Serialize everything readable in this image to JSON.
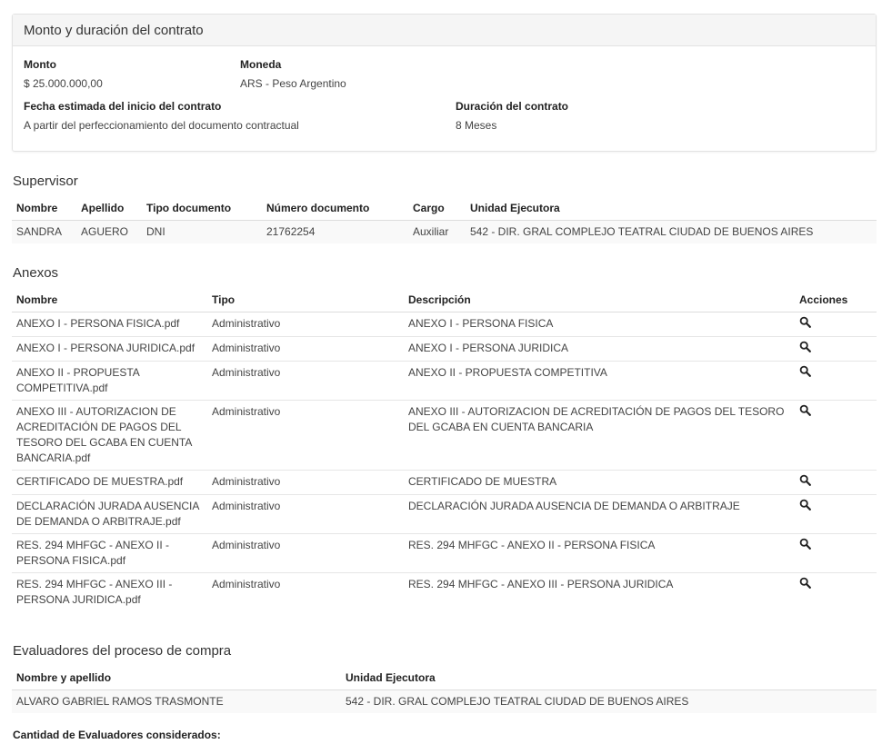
{
  "contract": {
    "title": "Monto y duración del contrato",
    "monto_label": "Monto",
    "monto_value": "$ 25.000.000,00",
    "moneda_label": "Moneda",
    "moneda_value": "ARS - Peso Argentino",
    "fecha_label": "Fecha estimada del inicio del contrato",
    "fecha_value": "A partir del perfeccionamiento del documento contractual",
    "duracion_label": "Duración del contrato",
    "duracion_value": "8 Meses"
  },
  "supervisor": {
    "title": "Supervisor",
    "headers": [
      "Nombre",
      "Apellido",
      "Tipo documento",
      "Número documento",
      "Cargo",
      "Unidad Ejecutora"
    ],
    "row": [
      "SANDRA",
      "AGUERO",
      "DNI",
      "21762254",
      "Auxiliar",
      "542 - DIR. GRAL COMPLEJO TEATRAL CIUDAD DE BUENOS AIRES"
    ]
  },
  "anexos": {
    "title": "Anexos",
    "headers": [
      "Nombre",
      "Tipo",
      "Descripción",
      "Acciones"
    ],
    "action_icon": "search-icon",
    "rows": [
      {
        "nombre": "ANEXO I - PERSONA FISICA.pdf",
        "tipo": "Administrativo",
        "descripcion": "ANEXO I - PERSONA FISICA"
      },
      {
        "nombre": "ANEXO I - PERSONA JURIDICA.pdf",
        "tipo": "Administrativo",
        "descripcion": "ANEXO I - PERSONA JURIDICA"
      },
      {
        "nombre": "ANEXO II - PROPUESTA COMPETITIVA.pdf",
        "tipo": "Administrativo",
        "descripcion": "ANEXO II - PROPUESTA COMPETITIVA"
      },
      {
        "nombre": "ANEXO III - AUTORIZACION DE ACREDITACIÓN DE PAGOS DEL TESORO DEL GCABA EN CUENTA BANCARIA.pdf",
        "tipo": "Administrativo",
        "descripcion": "ANEXO III - AUTORIZACION DE ACREDITACIÓN DE PAGOS DEL TESORO DEL GCABA EN CUENTA BANCARIA"
      },
      {
        "nombre": "CERTIFICADO DE MUESTRA.pdf",
        "tipo": "Administrativo",
        "descripcion": "CERTIFICADO DE MUESTRA"
      },
      {
        "nombre": "DECLARACIÓN JURADA AUSENCIA DE DEMANDA O ARBITRAJE.pdf",
        "tipo": "Administrativo",
        "descripcion": "DECLARACIÓN JURADA AUSENCIA DE DEMANDA O ARBITRAJE"
      },
      {
        "nombre": "RES. 294 MHFGC - ANEXO II - PERSONA FISICA.pdf",
        "tipo": "Administrativo",
        "descripcion": "RES. 294 MHFGC - ANEXO II - PERSONA FISICA"
      },
      {
        "nombre": "RES. 294 MHFGC - ANEXO III - PERSONA JURIDICA.pdf",
        "tipo": "Administrativo",
        "descripcion": "RES. 294 MHFGC - ANEXO III - PERSONA JURIDICA"
      }
    ]
  },
  "evaluadores": {
    "title": "Evaluadores del proceso de compra",
    "headers": [
      "Nombre y apellido",
      "Unidad Ejecutora"
    ],
    "row": [
      "ALVARO GABRIEL RAMOS TRASMONTE",
      "542 - DIR. GRAL COMPLEJO TEATRAL CIUDAD DE BUENOS AIRES"
    ],
    "cantidad_label": "Cantidad de Evaluadores considerados:"
  }
}
